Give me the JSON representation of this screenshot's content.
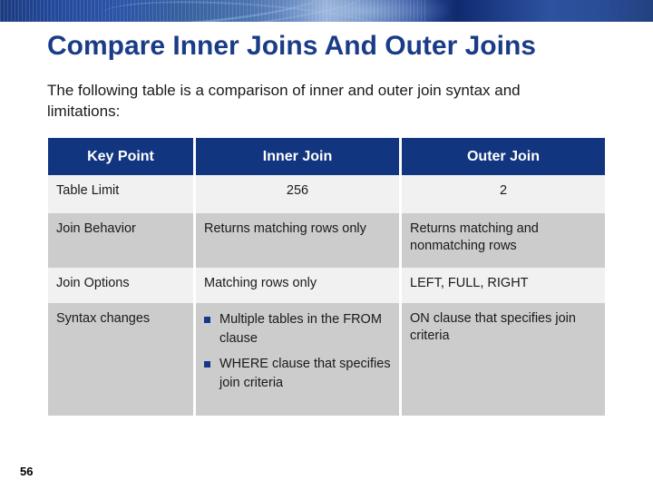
{
  "slide": {
    "title": "Compare Inner Joins And Outer Joins",
    "intro": "The following table is a comparison of inner and outer join syntax and limitations:",
    "page_number": "56",
    "accent_color": "#12357f",
    "title_color": "#1a3c87",
    "bullet_color": "#17378a",
    "row_light_color": "#f1f1f1",
    "row_dark_color": "#cccccc"
  },
  "table": {
    "columns": [
      {
        "label": "Key Point"
      },
      {
        "label": "Inner Join"
      },
      {
        "label": "Outer Join"
      }
    ],
    "rows": [
      {
        "key_point": "Table Limit",
        "inner_join": "256",
        "outer_join": "2"
      },
      {
        "key_point": "Join Behavior",
        "inner_join": "Returns matching rows only",
        "outer_join": "Returns matching and nonmatching rows"
      },
      {
        "key_point": "Join Options",
        "inner_join": "Matching rows only",
        "outer_join": "LEFT, FULL, RIGHT"
      },
      {
        "key_point": "Syntax changes",
        "inner_join_bullets": [
          "Multiple tables in the FROM clause",
          "WHERE clause that specifies join criteria"
        ],
        "outer_join": "ON clause that specifies join criteria"
      }
    ]
  }
}
